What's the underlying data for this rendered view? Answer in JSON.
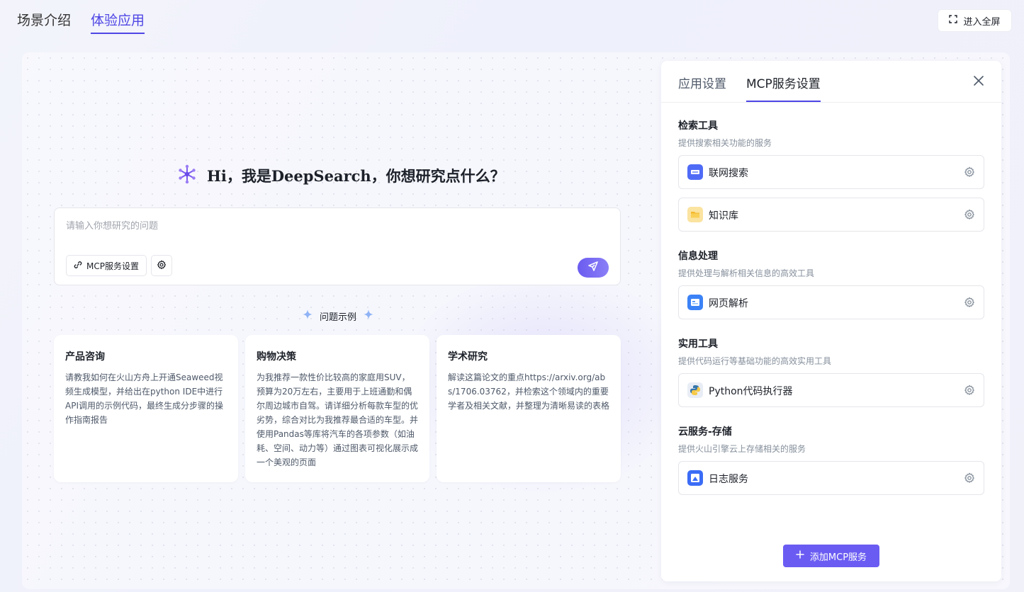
{
  "nav": {
    "tabs": [
      {
        "label": "场景介绍",
        "active": false
      },
      {
        "label": "体验应用",
        "active": true
      }
    ],
    "fullscreen_label": "进入全屏"
  },
  "hero": {
    "title": "Hi，我是DeepSearch，你想研究点什么？",
    "icon": "sparkle-network-icon"
  },
  "input": {
    "value": "",
    "placeholder": "请输入你想研究的问题",
    "mcp_button_label": "MCP服务设置"
  },
  "examples": {
    "label": "问题示例",
    "cards": [
      {
        "title": "产品咨询",
        "body": "请教我如何在火山方舟上开通Seaweed视频生成模型，并给出在python IDE中进行API调用的示例代码，最终生成分步骤的操作指南报告"
      },
      {
        "title": "购物决策",
        "body": "为我推荐一款性价比较高的家庭用SUV，预算为20万左右，主要用于上班通勤和偶尔周边城市自驾。请详细分析每款车型的优劣势，综合对比为我推荐最合适的车型。并使用Pandas等库将汽车的各项参数（如油耗、空间、动力等）通过图表可视化展示成一个美观的页面"
      },
      {
        "title": "学术研究",
        "body": "解读这篇论文的重点https://arxiv.org/abs/1706.03762，并检索这个领域内的重要学者及相关文献，并整理为清晰易读的表格"
      }
    ]
  },
  "panel": {
    "tabs": [
      {
        "label": "应用设置",
        "active": false
      },
      {
        "label": "MCP服务设置",
        "active": true
      }
    ],
    "sections": [
      {
        "title": "检索工具",
        "desc": "提供搜索相关功能的服务",
        "services": [
          {
            "name": "联网搜索",
            "icon": "web-search-icon",
            "color": "#4f6bf6"
          },
          {
            "name": "知识库",
            "icon": "folder-icon",
            "color": "#f7c948"
          }
        ]
      },
      {
        "title": "信息处理",
        "desc": "提供处理与解析相关信息的高效工具",
        "services": [
          {
            "name": "网页解析",
            "icon": "webpage-parse-icon",
            "color": "#3b82f6"
          }
        ]
      },
      {
        "title": "实用工具",
        "desc": "提供代码运行等基础功能的高效实用工具",
        "services": [
          {
            "name": "Python代码执行器",
            "icon": "python-icon",
            "color": "#3776ab"
          }
        ]
      },
      {
        "title": "云服务-存储",
        "desc": "提供火山引擎云上存储相关的服务",
        "services": [
          {
            "name": "日志服务",
            "icon": "log-service-icon",
            "color": "#3b6cf6"
          }
        ]
      }
    ],
    "add_button_label": "添加MCP服务"
  },
  "colors": {
    "accent": "#4f46e5",
    "button": "#6a5cf2"
  }
}
